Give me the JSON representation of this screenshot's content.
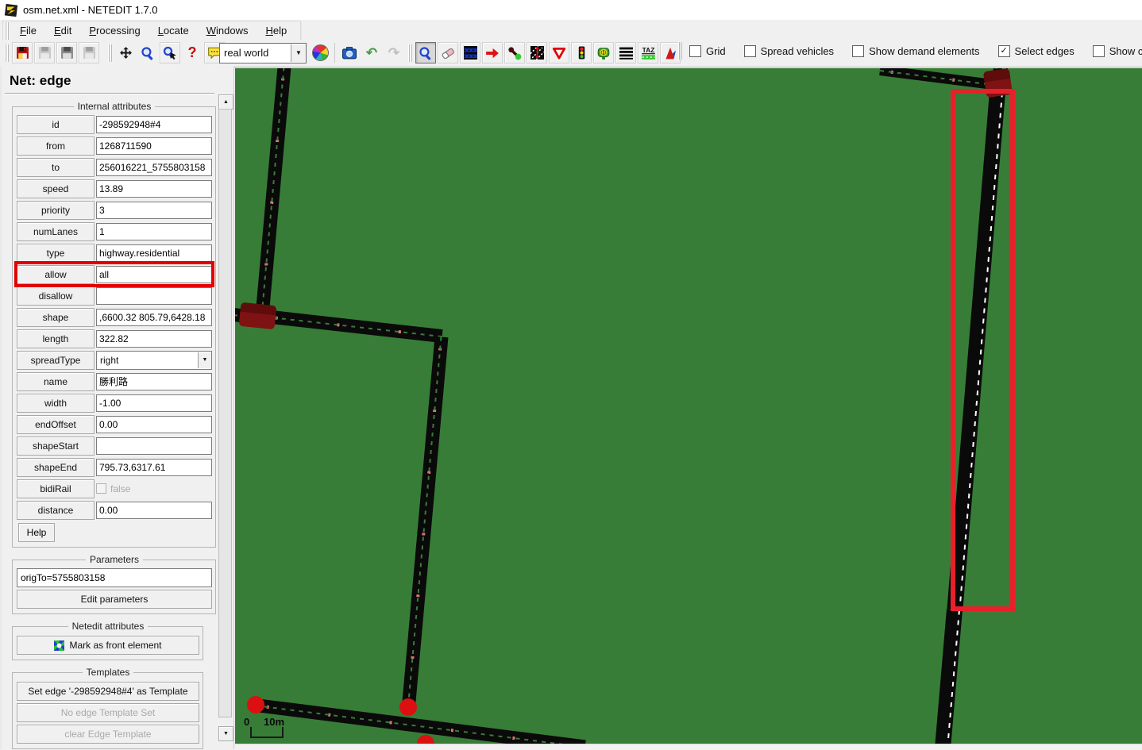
{
  "window": {
    "title": "osm.net.xml - NETEDIT 1.7.0"
  },
  "menu": {
    "items": [
      "File",
      "Edit",
      "Processing",
      "Locate",
      "Windows",
      "Help"
    ]
  },
  "toolbar": {
    "view_mode": "real world",
    "checkboxes": [
      {
        "label": "Grid",
        "checked": false
      },
      {
        "label": "Spread vehicles",
        "checked": false
      },
      {
        "label": "Show demand elements",
        "checked": false
      },
      {
        "label": "Select edges",
        "checked": true
      },
      {
        "label": "Show conne",
        "checked": false
      }
    ],
    "icons": {
      "save-network-icon": "floppy-red",
      "save-additional-icon": "floppy-gray",
      "save-demand-icon": "floppy-dark",
      "save-data-icon": "floppy-gray",
      "move-view-icon": "four-way-arrow",
      "zoom-icon": "magnifier",
      "zoom-selection-icon": "magnifier-cursor",
      "help-icon": "?",
      "chat-icon": "speech-bubble",
      "color-wheel-icon": "color-wheel",
      "snapshot-icon": "camera",
      "undo-icon": "↶",
      "redo-icon": "↷",
      "inspect-mode-icon": "magnifier",
      "delete-mode-icon": "eraser",
      "select-mode-icon": "road-blue-dashes",
      "move-mode-icon": "red-right-arrow",
      "connection-mode-icon": "dot-link",
      "crossing-mode-icon": "crossing-square",
      "prohibition-mode-icon": "▽",
      "traffic-light-mode-icon": "traffic-light",
      "additional-mode-icon": "bus-stop-H",
      "shape-mode-icon": "horizontal-bars",
      "taz-mode-icon": "TAZ",
      "polygon-mode-icon": "red-polygon"
    }
  },
  "inspector": {
    "title": "Net: edge",
    "internal_attributes": {
      "legend": "Internal attributes",
      "rows": [
        {
          "key": "id",
          "value": "-298592948#4"
        },
        {
          "key": "from",
          "value": "1268711590"
        },
        {
          "key": "to",
          "value": "256016221_5755803158"
        },
        {
          "key": "speed",
          "value": "13.89"
        },
        {
          "key": "priority",
          "value": "3"
        },
        {
          "key": "numLanes",
          "value": "1"
        },
        {
          "key": "type",
          "value": "highway.residential"
        },
        {
          "key": "allow",
          "value": "all",
          "highlighted": true
        },
        {
          "key": "disallow",
          "value": ""
        },
        {
          "key": "shape",
          "value": ",6600.32 805.79,6428.18"
        },
        {
          "key": "length",
          "value": "322.82"
        },
        {
          "key": "spreadType",
          "value": "right",
          "kind": "select"
        },
        {
          "key": "name",
          "value": "勝利路"
        },
        {
          "key": "width",
          "value": "-1.00"
        },
        {
          "key": "endOffset",
          "value": "0.00"
        },
        {
          "key": "shapeStart",
          "value": ""
        },
        {
          "key": "shapeEnd",
          "value": "795.73,6317.61"
        },
        {
          "key": "bidiRail",
          "value": "false",
          "kind": "checkbox"
        },
        {
          "key": "distance",
          "value": "0.00"
        }
      ],
      "help_label": "Help"
    },
    "parameters": {
      "legend": "Parameters",
      "value": "origTo=5755803158",
      "edit_label": "Edit parameters"
    },
    "netedit_attributes": {
      "legend": "Netedit attributes",
      "front_label": "Mark as front element"
    },
    "templates": {
      "legend": "Templates",
      "set_label": "Set edge '-298592948#4' as Template",
      "no_template_label": "No edge Template Set",
      "clear_label": "clear Edge Template"
    }
  },
  "canvas": {
    "scale_zero": "0",
    "scale_ten": "10m"
  }
}
